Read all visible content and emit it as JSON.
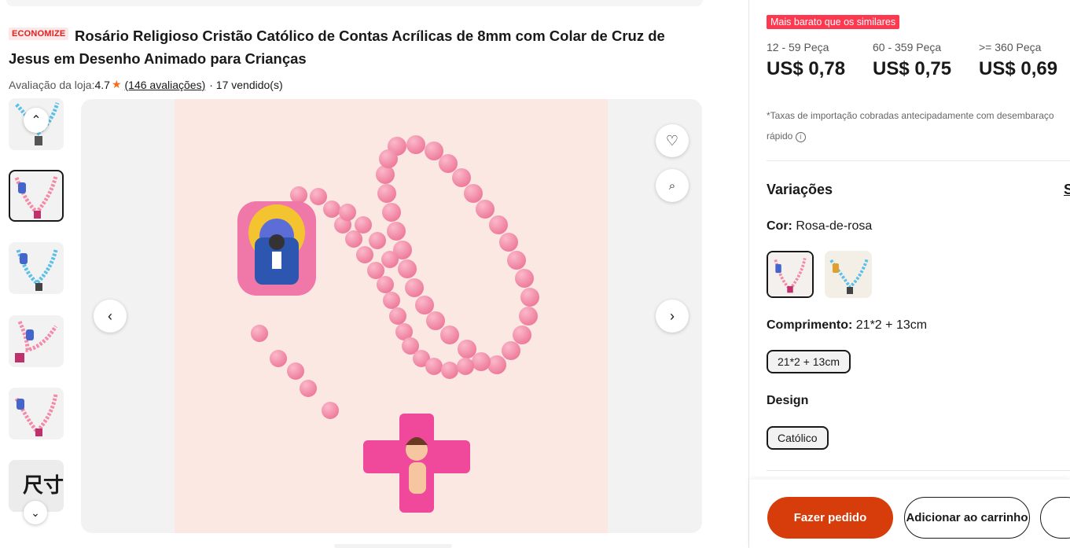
{
  "product": {
    "badge": "ECONOMIZE",
    "title": "Rosário Religioso Cristão Católico de Contas Acrílicas de 8mm com Colar de Cruz de Jesus em Desenho Animado para Crianças",
    "rating_prefix": "Avaliação da loja:",
    "rating_value": "4.7",
    "reviews_link": "(146 avaliações)",
    "sold": "· 17 vendido(s)"
  },
  "gallery": {
    "thumbnails": [
      "blue",
      "pink",
      "blue",
      "pink",
      "pink",
      "size-chart"
    ],
    "selected_index": 1,
    "size_chart_glyph": "尺寸"
  },
  "icons": {
    "thumb_up": "chevron-up-icon",
    "thumb_down": "chevron-down-icon",
    "prev": "chevron-left-icon",
    "next": "chevron-right-icon",
    "wishlist": "heart-icon",
    "image_search": "image-search-icon",
    "info": "info-icon",
    "star": "star-icon"
  },
  "pricing": {
    "cheaper_badge": "Mais barato que os similares",
    "tiers": [
      {
        "qty": "12 - 59 Peça",
        "price": "US$ 0,78"
      },
      {
        "qty": "60 - 359 Peça",
        "price": "US$ 0,75"
      },
      {
        "qty": ">= 360 Peça",
        "price": "US$ 0,69"
      }
    ],
    "tax_line1": "*Taxas de importação cobradas antecipadamente com desembaraço",
    "tax_line2": "rápido"
  },
  "variations": {
    "title": "Variações",
    "more": "S",
    "color_label": "Cor:",
    "color_value": "Rosa-de-rosa",
    "length_label": "Comprimento:",
    "length_value": "21*2 + 13cm",
    "length_option": "21*2 + 13cm",
    "design_label": "Design",
    "design_option": "Católico"
  },
  "actions": {
    "order": "Fazer pedido",
    "cart": "Adicionar ao carrinho"
  },
  "colors": {
    "accent": "#d63d0a",
    "badge_red": "#fd384f",
    "star": "#f96c17",
    "bead_pink": "#f48aa8"
  }
}
